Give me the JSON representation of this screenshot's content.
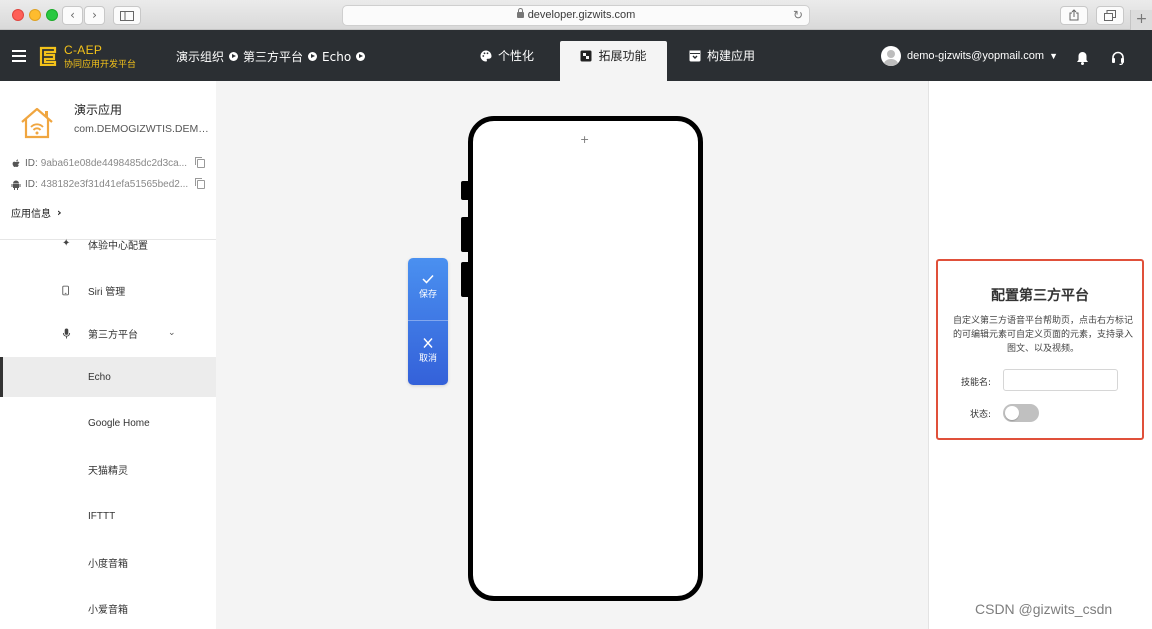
{
  "browser": {
    "url": "developer.gizwits.com"
  },
  "header": {
    "logo_title": "C-AEP",
    "logo_subtitle": "协同应用开发平台",
    "breadcrumb": [
      "演示组织",
      "第三方平台",
      "Echo"
    ],
    "tabs": [
      {
        "label": "个性化",
        "icon": "palette-icon",
        "active": false
      },
      {
        "label": "拓展功能",
        "icon": "extension-icon",
        "active": true
      },
      {
        "label": "构建应用",
        "icon": "build-box-icon",
        "active": false
      }
    ],
    "user_email": "demo-gizwits@yopmail.com"
  },
  "sidebar": {
    "app_name": "演示应用",
    "app_package": "com.DEMOGIZWTIS.DEMO...",
    "ios_id_label": "ID:",
    "ios_id": "9aba61e08de4498485dc2d3ca...",
    "android_id_label": "ID:",
    "android_id": "438182e3f31d41efa51565bed2...",
    "app_info_label": "应用信息",
    "nav": [
      {
        "label": "体验中心配置",
        "icon": "magic-wand-icon"
      },
      {
        "label": "Siri 管理",
        "icon": "phone-icon"
      },
      {
        "label": "第三方平台",
        "icon": "microphone-icon",
        "expanded": true
      },
      {
        "label": "Echo",
        "selected": true
      },
      {
        "label": "Google Home"
      },
      {
        "label": "天猫精灵"
      },
      {
        "label": "IFTTT"
      },
      {
        "label": "小度音箱"
      },
      {
        "label": "小爱音箱"
      }
    ]
  },
  "canvas": {
    "plus_marker": "+",
    "save_label": "保存",
    "cancel_label": "取消"
  },
  "config_panel": {
    "title": "配置第三方平台",
    "description": "自定义第三方语音平台帮助页，点击右方标记的可编辑元素可自定义页面的元素，支持录入图文、以及视频。",
    "skill_name_label": "技能名:",
    "skill_name_value": "",
    "status_label": "状态:",
    "status_on": false
  },
  "watermark": "CSDN @gizwits_csdn",
  "colors": {
    "header_bg": "#2b2f33",
    "logo_yellow": "#f3c21a",
    "action_blue": "#3d7ae6",
    "highlight_red": "#e0503a"
  }
}
